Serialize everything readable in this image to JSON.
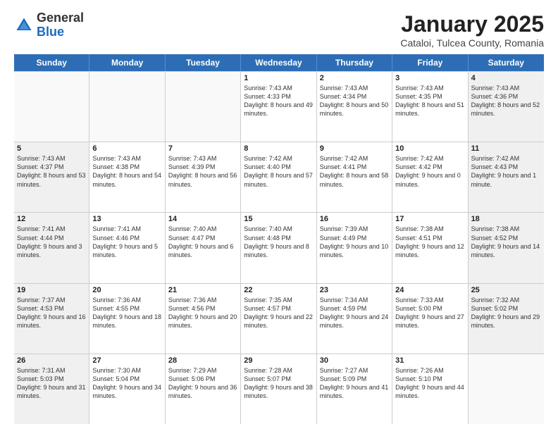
{
  "logo": {
    "general": "General",
    "blue": "Blue"
  },
  "header": {
    "title": "January 2025",
    "subtitle": "Cataloi, Tulcea County, Romania"
  },
  "weekdays": [
    "Sunday",
    "Monday",
    "Tuesday",
    "Wednesday",
    "Thursday",
    "Friday",
    "Saturday"
  ],
  "weeks": [
    [
      {
        "day": "",
        "empty": true
      },
      {
        "day": "",
        "empty": true
      },
      {
        "day": "",
        "empty": true
      },
      {
        "day": "1",
        "sunrise": "Sunrise: 7:43 AM",
        "sunset": "Sunset: 4:33 PM",
        "daylight": "Daylight: 8 hours and 49 minutes."
      },
      {
        "day": "2",
        "sunrise": "Sunrise: 7:43 AM",
        "sunset": "Sunset: 4:34 PM",
        "daylight": "Daylight: 8 hours and 50 minutes."
      },
      {
        "day": "3",
        "sunrise": "Sunrise: 7:43 AM",
        "sunset": "Sunset: 4:35 PM",
        "daylight": "Daylight: 8 hours and 51 minutes."
      },
      {
        "day": "4",
        "sunrise": "Sunrise: 7:43 AM",
        "sunset": "Sunset: 4:36 PM",
        "daylight": "Daylight: 8 hours and 52 minutes.",
        "shaded": true
      }
    ],
    [
      {
        "day": "5",
        "sunrise": "Sunrise: 7:43 AM",
        "sunset": "Sunset: 4:37 PM",
        "daylight": "Daylight: 8 hours and 53 minutes.",
        "shaded": true
      },
      {
        "day": "6",
        "sunrise": "Sunrise: 7:43 AM",
        "sunset": "Sunset: 4:38 PM",
        "daylight": "Daylight: 8 hours and 54 minutes."
      },
      {
        "day": "7",
        "sunrise": "Sunrise: 7:43 AM",
        "sunset": "Sunset: 4:39 PM",
        "daylight": "Daylight: 8 hours and 56 minutes."
      },
      {
        "day": "8",
        "sunrise": "Sunrise: 7:42 AM",
        "sunset": "Sunset: 4:40 PM",
        "daylight": "Daylight: 8 hours and 57 minutes."
      },
      {
        "day": "9",
        "sunrise": "Sunrise: 7:42 AM",
        "sunset": "Sunset: 4:41 PM",
        "daylight": "Daylight: 8 hours and 58 minutes."
      },
      {
        "day": "10",
        "sunrise": "Sunrise: 7:42 AM",
        "sunset": "Sunset: 4:42 PM",
        "daylight": "Daylight: 9 hours and 0 minutes."
      },
      {
        "day": "11",
        "sunrise": "Sunrise: 7:42 AM",
        "sunset": "Sunset: 4:43 PM",
        "daylight": "Daylight: 9 hours and 1 minute.",
        "shaded": true
      }
    ],
    [
      {
        "day": "12",
        "sunrise": "Sunrise: 7:41 AM",
        "sunset": "Sunset: 4:44 PM",
        "daylight": "Daylight: 9 hours and 3 minutes.",
        "shaded": true
      },
      {
        "day": "13",
        "sunrise": "Sunrise: 7:41 AM",
        "sunset": "Sunset: 4:46 PM",
        "daylight": "Daylight: 9 hours and 5 minutes."
      },
      {
        "day": "14",
        "sunrise": "Sunrise: 7:40 AM",
        "sunset": "Sunset: 4:47 PM",
        "daylight": "Daylight: 9 hours and 6 minutes."
      },
      {
        "day": "15",
        "sunrise": "Sunrise: 7:40 AM",
        "sunset": "Sunset: 4:48 PM",
        "daylight": "Daylight: 9 hours and 8 minutes."
      },
      {
        "day": "16",
        "sunrise": "Sunrise: 7:39 AM",
        "sunset": "Sunset: 4:49 PM",
        "daylight": "Daylight: 9 hours and 10 minutes."
      },
      {
        "day": "17",
        "sunrise": "Sunrise: 7:38 AM",
        "sunset": "Sunset: 4:51 PM",
        "daylight": "Daylight: 9 hours and 12 minutes."
      },
      {
        "day": "18",
        "sunrise": "Sunrise: 7:38 AM",
        "sunset": "Sunset: 4:52 PM",
        "daylight": "Daylight: 9 hours and 14 minutes.",
        "shaded": true
      }
    ],
    [
      {
        "day": "19",
        "sunrise": "Sunrise: 7:37 AM",
        "sunset": "Sunset: 4:53 PM",
        "daylight": "Daylight: 9 hours and 16 minutes.",
        "shaded": true
      },
      {
        "day": "20",
        "sunrise": "Sunrise: 7:36 AM",
        "sunset": "Sunset: 4:55 PM",
        "daylight": "Daylight: 9 hours and 18 minutes."
      },
      {
        "day": "21",
        "sunrise": "Sunrise: 7:36 AM",
        "sunset": "Sunset: 4:56 PM",
        "daylight": "Daylight: 9 hours and 20 minutes."
      },
      {
        "day": "22",
        "sunrise": "Sunrise: 7:35 AM",
        "sunset": "Sunset: 4:57 PM",
        "daylight": "Daylight: 9 hours and 22 minutes."
      },
      {
        "day": "23",
        "sunrise": "Sunrise: 7:34 AM",
        "sunset": "Sunset: 4:59 PM",
        "daylight": "Daylight: 9 hours and 24 minutes."
      },
      {
        "day": "24",
        "sunrise": "Sunrise: 7:33 AM",
        "sunset": "Sunset: 5:00 PM",
        "daylight": "Daylight: 9 hours and 27 minutes."
      },
      {
        "day": "25",
        "sunrise": "Sunrise: 7:32 AM",
        "sunset": "Sunset: 5:02 PM",
        "daylight": "Daylight: 9 hours and 29 minutes.",
        "shaded": true
      }
    ],
    [
      {
        "day": "26",
        "sunrise": "Sunrise: 7:31 AM",
        "sunset": "Sunset: 5:03 PM",
        "daylight": "Daylight: 9 hours and 31 minutes.",
        "shaded": true
      },
      {
        "day": "27",
        "sunrise": "Sunrise: 7:30 AM",
        "sunset": "Sunset: 5:04 PM",
        "daylight": "Daylight: 9 hours and 34 minutes."
      },
      {
        "day": "28",
        "sunrise": "Sunrise: 7:29 AM",
        "sunset": "Sunset: 5:06 PM",
        "daylight": "Daylight: 9 hours and 36 minutes."
      },
      {
        "day": "29",
        "sunrise": "Sunrise: 7:28 AM",
        "sunset": "Sunset: 5:07 PM",
        "daylight": "Daylight: 9 hours and 38 minutes."
      },
      {
        "day": "30",
        "sunrise": "Sunrise: 7:27 AM",
        "sunset": "Sunset: 5:09 PM",
        "daylight": "Daylight: 9 hours and 41 minutes."
      },
      {
        "day": "31",
        "sunrise": "Sunrise: 7:26 AM",
        "sunset": "Sunset: 5:10 PM",
        "daylight": "Daylight: 9 hours and 44 minutes."
      },
      {
        "day": "",
        "empty": true,
        "shaded": true
      }
    ]
  ]
}
